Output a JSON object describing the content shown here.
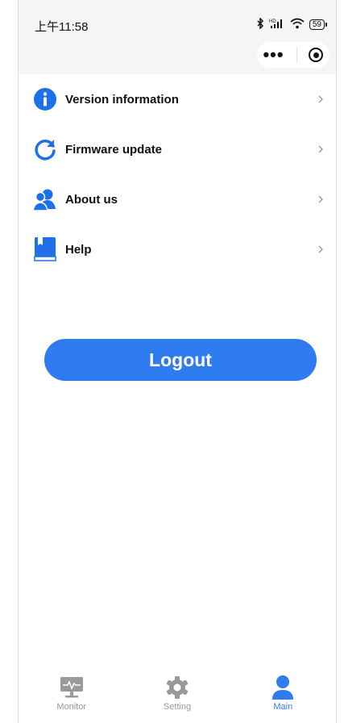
{
  "status": {
    "time": "上午11:58",
    "battery": "59",
    "network": "HD"
  },
  "colors": {
    "accent": "#2f7cf0",
    "icon_blue": "#1e6fe8",
    "tab_inactive": "#9a9a9a"
  },
  "menu": {
    "items": [
      {
        "label": "Version information",
        "icon": "info-icon"
      },
      {
        "label": "Firmware update",
        "icon": "refresh-icon"
      },
      {
        "label": "About us",
        "icon": "users-icon"
      },
      {
        "label": "Help",
        "icon": "book-icon"
      }
    ]
  },
  "logout_label": "Logout",
  "tabs": [
    {
      "label": "Monitor",
      "icon": "monitor-icon",
      "active": false
    },
    {
      "label": "Setting",
      "icon": "gear-icon",
      "active": false
    },
    {
      "label": "Main",
      "icon": "person-icon",
      "active": true
    }
  ]
}
